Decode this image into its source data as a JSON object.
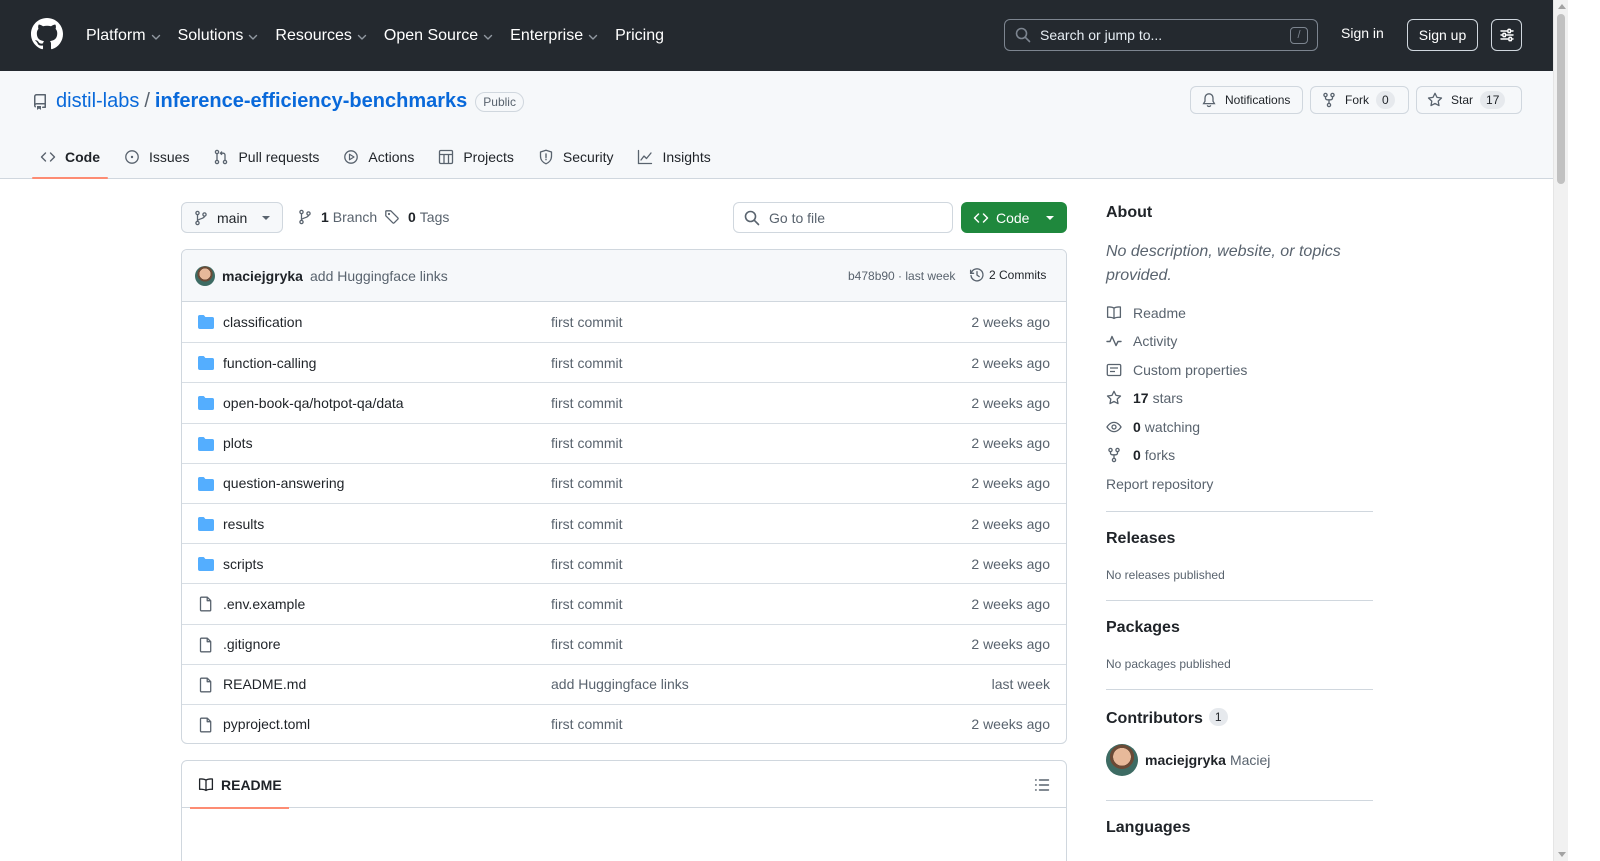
{
  "header": {
    "nav": [
      {
        "label": "Platform",
        "dropdown": true
      },
      {
        "label": "Solutions",
        "dropdown": true
      },
      {
        "label": "Resources",
        "dropdown": true
      },
      {
        "label": "Open Source",
        "dropdown": true
      },
      {
        "label": "Enterprise",
        "dropdown": true
      },
      {
        "label": "Pricing",
        "dropdown": false
      }
    ],
    "search_placeholder": "Search or jump to...",
    "search_shortcut": "/",
    "sign_in": "Sign in",
    "sign_up": "Sign up"
  },
  "repo": {
    "owner": "distil-labs",
    "separator": "/",
    "name": "inference-efficiency-benchmarks",
    "visibility": "Public",
    "notifications_label": "Notifications",
    "fork_label": "Fork",
    "fork_count": "0",
    "star_label": "Star",
    "star_count": "17",
    "tabs": [
      {
        "label": "Code",
        "icon": "code-icon"
      },
      {
        "label": "Issues",
        "icon": "issue-icon"
      },
      {
        "label": "Pull requests",
        "icon": "pull-request-icon"
      },
      {
        "label": "Actions",
        "icon": "play-icon"
      },
      {
        "label": "Projects",
        "icon": "table-icon"
      },
      {
        "label": "Security",
        "icon": "shield-icon"
      },
      {
        "label": "Insights",
        "icon": "graph-icon"
      }
    ],
    "active_tab": "Code"
  },
  "toolbar": {
    "branch": "main",
    "branch_count": "1",
    "branch_label": "Branch",
    "tag_count": "0",
    "tag_label": "Tags",
    "goto_file_placeholder": "Go to file",
    "code_button": "Code"
  },
  "latest_commit": {
    "author": "maciejgryka",
    "message": "add Huggingface links",
    "sha_time": "b478b90 · last week",
    "commits": "2 Commits"
  },
  "files": [
    {
      "type": "dir",
      "name": "classification",
      "message": "first commit",
      "date": "2 weeks ago"
    },
    {
      "type": "dir",
      "name": "function-calling",
      "message": "first commit",
      "date": "2 weeks ago"
    },
    {
      "type": "dir",
      "name": "open-book-qa/hotpot-qa/data",
      "message": "first commit",
      "date": "2 weeks ago"
    },
    {
      "type": "dir",
      "name": "plots",
      "message": "first commit",
      "date": "2 weeks ago"
    },
    {
      "type": "dir",
      "name": "question-answering",
      "message": "first commit",
      "date": "2 weeks ago"
    },
    {
      "type": "dir",
      "name": "results",
      "message": "first commit",
      "date": "2 weeks ago"
    },
    {
      "type": "dir",
      "name": "scripts",
      "message": "first commit",
      "date": "2 weeks ago"
    },
    {
      "type": "file",
      "name": ".env.example",
      "message": "first commit",
      "date": "2 weeks ago"
    },
    {
      "type": "file",
      "name": ".gitignore",
      "message": "first commit",
      "date": "2 weeks ago"
    },
    {
      "type": "file",
      "name": "README.md",
      "message": "add Huggingface links",
      "date": "last week"
    },
    {
      "type": "file",
      "name": "pyproject.toml",
      "message": "first commit",
      "date": "2 weeks ago"
    }
  ],
  "readme": {
    "tab_label": "README"
  },
  "sidebar": {
    "about_title": "About",
    "about_desc": "No description, website, or topics provided.",
    "readme": "Readme",
    "activity": "Activity",
    "custom_properties": "Custom properties",
    "stars_count": "17",
    "stars_label": "stars",
    "watching_count": "0",
    "watching_label": "watching",
    "forks_count": "0",
    "forks_label": "forks",
    "report": "Report repository",
    "releases_title": "Releases",
    "releases_empty": "No releases published",
    "packages_title": "Packages",
    "packages_empty": "No packages published",
    "contributors_title": "Contributors",
    "contributors_count": "1",
    "contributor_user": "maciejgryka",
    "contributor_name": "Maciej",
    "languages_title": "Languages"
  },
  "colors": {
    "header_bg": "#24292f",
    "link": "#0969da",
    "primary_button": "#1f883d",
    "active_tab_underline": "#fd8c73",
    "folder": "#54aeff"
  }
}
